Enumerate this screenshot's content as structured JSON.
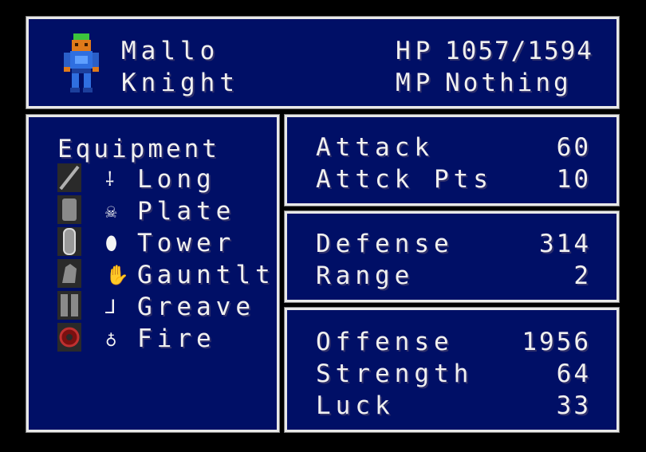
{
  "character": {
    "name": "Mallo",
    "class": "Knight",
    "hp_label": "HP",
    "hp_value": "1057/1594",
    "mp_label": "MP",
    "mp_value": "Nothing"
  },
  "equipment": {
    "header": "Equipment",
    "items": [
      {
        "icon": "sword-icon",
        "glyph": "⸸",
        "name": "Long"
      },
      {
        "icon": "armor-icon",
        "glyph": "☠",
        "name": "Plate"
      },
      {
        "icon": "shield-icon",
        "glyph": "⬮",
        "name": "Tower"
      },
      {
        "icon": "gauntlet-icon",
        "glyph": "✋",
        "name": "Gauntlt"
      },
      {
        "icon": "greave-icon",
        "glyph": "⅃",
        "name": "Greave"
      },
      {
        "icon": "ring-icon",
        "glyph": "♁",
        "name": "Fire"
      }
    ]
  },
  "stats": {
    "attack": {
      "label": "Attack",
      "value": "60"
    },
    "attack_pts": {
      "label": "Attck Pts",
      "value": "10"
    },
    "defense": {
      "label": "Defense",
      "value": "314"
    },
    "range": {
      "label": "Range",
      "value": "2"
    },
    "offense": {
      "label": "Offense",
      "value": "1956"
    },
    "strength": {
      "label": "Strength",
      "value": "64"
    },
    "luck": {
      "label": "Luck",
      "value": "33"
    }
  },
  "colors": {
    "panel_bg": "#000f66",
    "border": "#e8e8e8",
    "text": "#f0f0f0"
  }
}
